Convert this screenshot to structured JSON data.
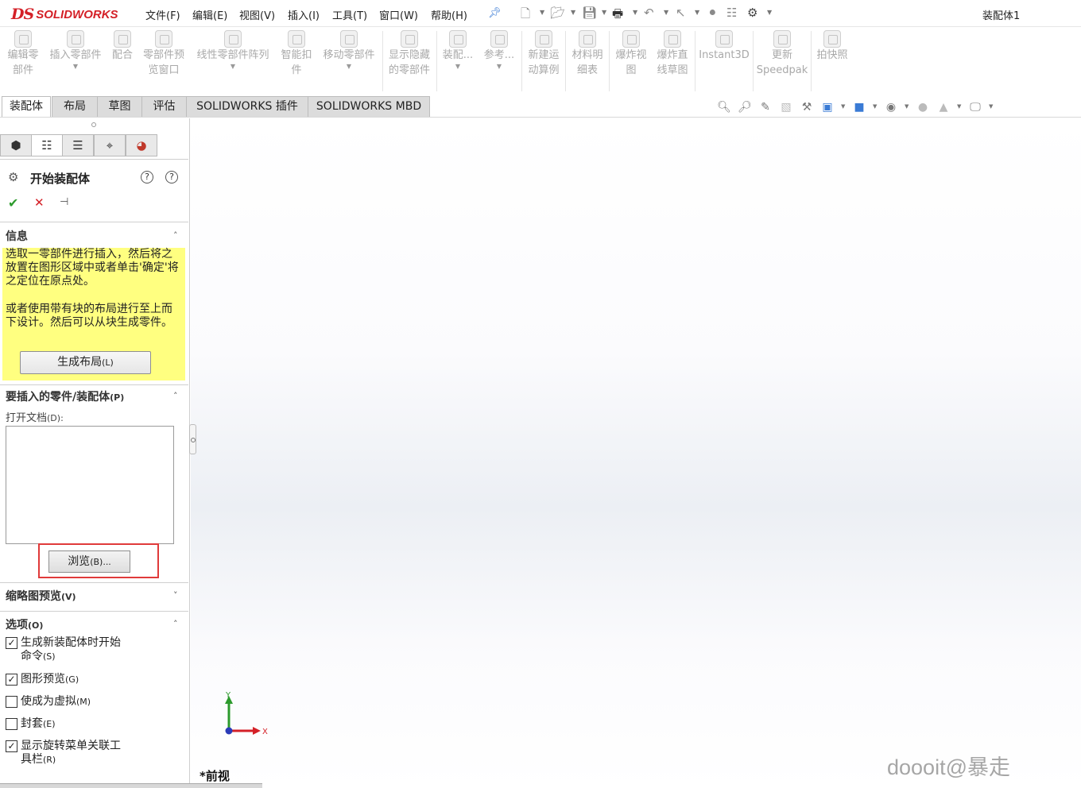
{
  "app": {
    "logo_ds": "DS",
    "logo_name": "SOLIDWORKS",
    "document_title": "装配体1"
  },
  "menu": [
    "文件(F)",
    "编辑(E)",
    "视图(V)",
    "插入(I)",
    "工具(T)",
    "窗口(W)",
    "帮助(H)"
  ],
  "ribbon": {
    "buttons": [
      {
        "l1": "编辑零",
        "l2": "部件"
      },
      {
        "l1": "插入零部件",
        "l2": ""
      },
      {
        "l1": "配合",
        "l2": ""
      },
      {
        "l1": "零部件预",
        "l2": "览窗口"
      },
      {
        "l1": "线性零部件阵列",
        "l2": ""
      },
      {
        "l1": "智能扣",
        "l2": "件"
      },
      {
        "l1": "移动零部件",
        "l2": ""
      },
      {
        "l1": "显示隐藏",
        "l2": "的零部件"
      },
      {
        "l1": "装配...",
        "l2": ""
      },
      {
        "l1": "参考...",
        "l2": ""
      },
      {
        "l1": "新建运",
        "l2": "动算例"
      },
      {
        "l1": "材料明",
        "l2": "细表"
      },
      {
        "l1": "爆炸视",
        "l2": "图"
      },
      {
        "l1": "爆炸直",
        "l2": "线草图"
      },
      {
        "l1": "Instant3D",
        "l2": ""
      },
      {
        "l1": "更新",
        "l2": "Speedpak"
      },
      {
        "l1": "拍快照",
        "l2": ""
      }
    ]
  },
  "tabs": [
    "装配体",
    "布局",
    "草图",
    "评估",
    "SOLIDWORKS 插件",
    "SOLIDWORKS MBD"
  ],
  "property_manager": {
    "title": "开始装配体",
    "info_section": "信息",
    "info_text_1": "选取一零部件进行插入，然后将之放置在图形区域中或者单击'确定'将之定位在原点处。",
    "info_text_2": "或者使用带有块的布局进行至上而下设计。然后可以从块生成零件。",
    "layout_button": "生成布局",
    "layout_shortcut": "(L)",
    "insert_section": "要插入的零件/装配体",
    "insert_shortcut": "(P)",
    "open_docs_label": "打开文档",
    "open_docs_shortcut": "(D):",
    "browse_button": "浏览",
    "browse_shortcut": "(B)...",
    "thumbnail_section": "缩略图预览",
    "thumbnail_shortcut": "(V)",
    "options_section": "选项",
    "options_shortcut": "(O)",
    "options": [
      {
        "line1": "生成新装配体时开始",
        "line2": "命令",
        "shortcut": "(S)",
        "checked": true
      },
      {
        "line1": "图形预览",
        "line2": "",
        "shortcut": "(G)",
        "checked": true
      },
      {
        "line1": "使成为虚拟",
        "line2": "",
        "shortcut": "(M)",
        "checked": false
      },
      {
        "line1": "封套",
        "line2": "",
        "shortcut": "(E)",
        "checked": false
      },
      {
        "line1": "显示旋转菜单关联工",
        "line2": "具栏",
        "shortcut": "(R)",
        "checked": true
      }
    ]
  },
  "graphics": {
    "view_name": "*前视",
    "triad_y": "Y",
    "triad_x": "X",
    "watermark": "doooit@暴走"
  },
  "colors": {
    "brand": "#d42027",
    "info_bg": "#ffff80",
    "highlight": "#e03a3a"
  }
}
